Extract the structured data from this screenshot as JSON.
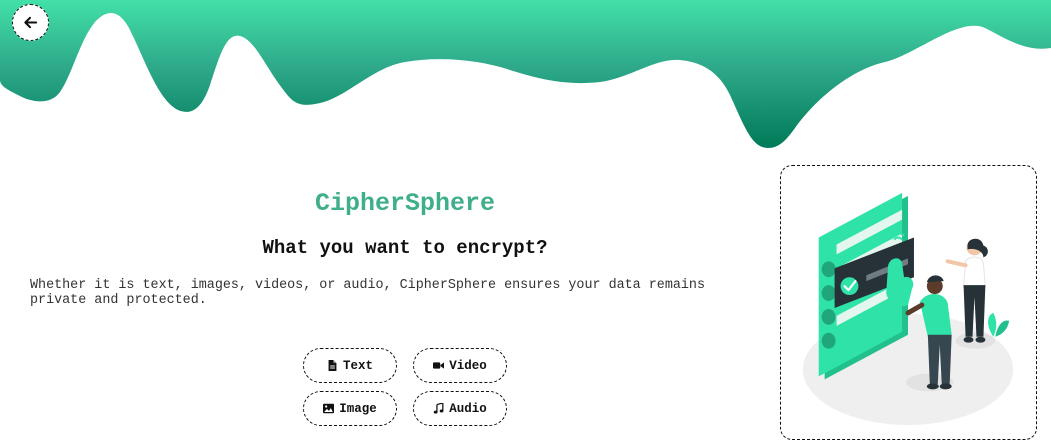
{
  "header": {
    "back_icon": "arrow-left-icon"
  },
  "hero": {
    "brand": "CipherSphere",
    "heading": "What you want to encrypt?",
    "description": "Whether it is text, images, videos, or audio, CipherSphere ensures your data remains private and protected."
  },
  "options": {
    "text": {
      "label": "Text",
      "icon": "file-icon"
    },
    "video": {
      "label": "Video",
      "icon": "video-camera-icon"
    },
    "image": {
      "label": "Image",
      "icon": "image-icon"
    },
    "audio": {
      "label": "Audio",
      "icon": "music-note-icon"
    }
  },
  "colors": {
    "accent": "#3fae8b",
    "wave_top": "#3fdca0",
    "wave_bottom": "#006f50",
    "illustration_green": "#2fe0a6",
    "illustration_dark": "#263238"
  }
}
